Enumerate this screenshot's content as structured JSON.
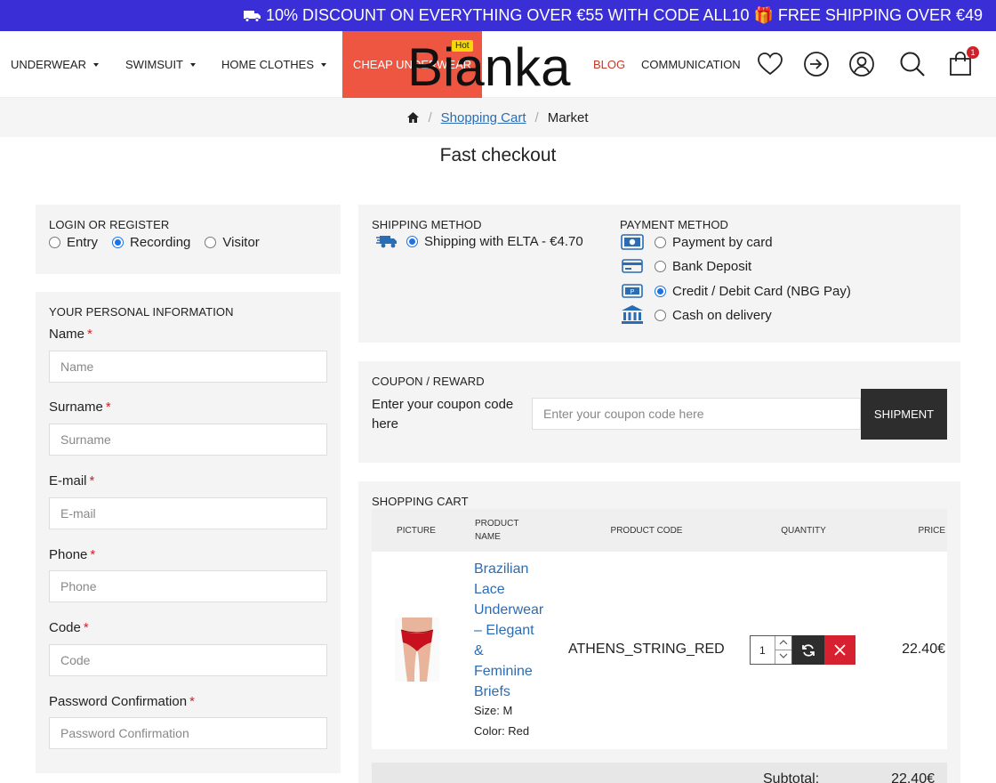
{
  "promo": {
    "text": "10% DISCOUNT ON EVERYTHING OVER €55 WITH CODE ALL10 🎁 FREE SHIPPING OVER €49"
  },
  "nav": {
    "underwear": "UNDERWEAR",
    "swimsuit": "SWIMSUIT",
    "home_clothes": "HOME CLOTHES",
    "cheap_underwear": "CHEAP UNDERWEAR",
    "hot_badge": "Hot",
    "logo": "Bianka",
    "blog": "BLOG",
    "communication": "COMMUNICATION",
    "cart_count": "1"
  },
  "breadcrumb": {
    "cart": "Shopping Cart",
    "current": "Market"
  },
  "page_title": "Fast checkout",
  "login": {
    "heading": "LOGIN OR REGISTER",
    "options": [
      "Entry",
      "Recording",
      "Visitor"
    ],
    "selected": "Recording"
  },
  "personal": {
    "heading": "YOUR PERSONAL INFORMATION",
    "fields": [
      {
        "label": "Name",
        "placeholder": "Name"
      },
      {
        "label": "Surname",
        "placeholder": "Surname"
      },
      {
        "label": "E-mail",
        "placeholder": "E-mail"
      },
      {
        "label": "Phone",
        "placeholder": "Phone"
      },
      {
        "label": "Code",
        "placeholder": "Code"
      },
      {
        "label": "Password Confirmation",
        "placeholder": "Password Confirmation"
      }
    ],
    "required_mark": "*"
  },
  "shipping": {
    "heading": "SHIPPING METHOD",
    "option": "Shipping with ELTA - €4.70"
  },
  "payment": {
    "heading": "PAYMENT METHOD",
    "options": [
      "Payment by card",
      "Bank Deposit",
      "Credit / Debit Card (NBG Pay)",
      "Cash on delivery"
    ],
    "selected": "Credit / Debit Card (NBG Pay)"
  },
  "coupon": {
    "heading": "COUPON / REWARD",
    "label": "Enter your coupon code here",
    "placeholder": "Enter your coupon code here",
    "button": "SHIPMENT"
  },
  "cart": {
    "heading": "SHOPPING CART",
    "columns": {
      "picture": "PICTURE",
      "name": "PRODUCT NAME",
      "code": "PRODUCT CODE",
      "quantity": "QUANTITY",
      "price": "PRICE"
    },
    "item": {
      "name": "Brazilian Lace Underwear – Elegant & Feminine Briefs",
      "size": "Size: M",
      "color": "Color: Red",
      "code": "ATHENS_STRING_RED",
      "quantity": "1",
      "price": "22.40€"
    },
    "subtotal_label": "Subtotal:",
    "subtotal_value": "22.40€"
  },
  "colors": {
    "promo_bg": "#3a2fd6",
    "hot_nav_bg": "#ee5641",
    "accent_red": "#d0202a",
    "link": "#2a6db5",
    "dark_button": "#2d2d2d"
  }
}
